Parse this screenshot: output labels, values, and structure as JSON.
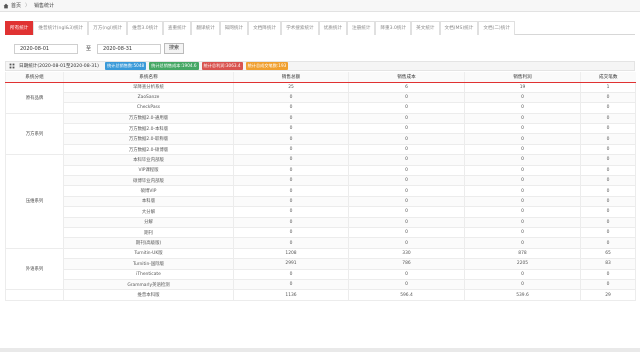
{
  "breadcrumb": {
    "home": "首页",
    "separator": "〉",
    "current": "销售统计"
  },
  "tabs": [
    "所有统计",
    "维普统计(ngl&3)统计",
    "万方(ngl)统计",
    "维普3.0统计",
    "查重统计",
    "翻译统计",
    "知网统计",
    "文档降统计",
    "学术搜索统计",
    "优质统计",
    "注册统计",
    "降重3.0统计",
    "英文统计",
    "文档(MS)统计",
    "文档(二)统计"
  ],
  "filter": {
    "start_date": "2020-08-01",
    "to_label": "至",
    "end_date": "2020-08-31",
    "search_label": "搜索"
  },
  "summary": {
    "title": "日期统计(2020-08-01至2020-08-31)",
    "badges": [
      {
        "text": "统计总销售数:5048",
        "color": "#3a9ad9"
      },
      {
        "text": "统计总销售成本:1904.6",
        "color": "#45a765"
      },
      {
        "text": "统计总利润:3063.4",
        "color": "#d9534f"
      },
      {
        "text": "统计总成交笔数:193",
        "color": "#f0a030"
      }
    ]
  },
  "table": {
    "headers": [
      "系统分组",
      "系统名称",
      "销售总额",
      "销售成本",
      "销售利润",
      "成交笔数"
    ],
    "groups": [
      {
        "name": "原有品牌",
        "rows": [
          [
            "早降查分析系统",
            "25",
            "6",
            "19",
            "1"
          ],
          [
            "ZaoSanze",
            "0",
            "0",
            "0",
            "0"
          ],
          [
            "CheckPass",
            "0",
            "0",
            "0",
            "0"
          ]
        ]
      },
      {
        "name": "万方系列",
        "rows": [
          [
            "万方数据2.0-通用版",
            "0",
            "0",
            "0",
            "0"
          ],
          [
            "万方数据2.0-本科版",
            "0",
            "0",
            "0",
            "0"
          ],
          [
            "万方数据2.0-职称版",
            "0",
            "0",
            "0",
            "0"
          ],
          [
            "万方数据2.0-硕博版",
            "0",
            "0",
            "0",
            "0"
          ]
        ]
      },
      {
        "name": "压维系列",
        "rows": [
          [
            "本科毕业内部版",
            "0",
            "0",
            "0",
            "0"
          ],
          [
            "VIP课程版",
            "0",
            "0",
            "0",
            "0"
          ],
          [
            "硕博毕业内部版",
            "0",
            "0",
            "0",
            "0"
          ],
          [
            "硕博VIP",
            "0",
            "0",
            "0",
            "0"
          ],
          [
            "本科版",
            "0",
            "0",
            "0",
            "0"
          ],
          [
            "大分解",
            "0",
            "0",
            "0",
            "0"
          ],
          [
            "分解",
            "0",
            "0",
            "0",
            "0"
          ],
          [
            "期刊",
            "0",
            "0",
            "0",
            "0"
          ],
          [
            "期刊(高级版)",
            "0",
            "0",
            "0",
            "0"
          ]
        ]
      },
      {
        "name": "外语系列",
        "rows": [
          [
            "Turnitin-UK版",
            "1208",
            "330",
            "878",
            "65"
          ],
          [
            "Turnitin-国际版",
            "2991",
            "786",
            "2205",
            "83"
          ],
          [
            "iThenticate",
            "0",
            "0",
            "0",
            "0"
          ],
          [
            "Grammarly英语检测",
            "0",
            "0",
            "0",
            "0"
          ]
        ]
      },
      {
        "name": "",
        "rows": [
          [
            "维普本科版",
            "1136",
            "596.4",
            "539.6",
            "29"
          ]
        ]
      }
    ]
  }
}
